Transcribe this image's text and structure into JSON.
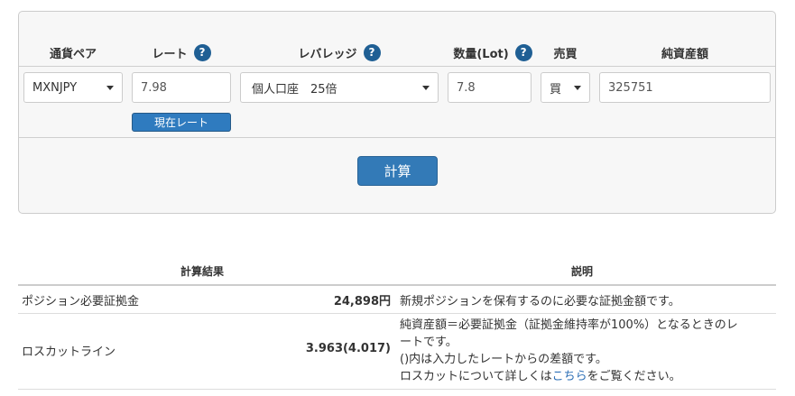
{
  "form": {
    "headers": {
      "pair": "通貨ペア",
      "rate": "レート",
      "leverage": "レバレッジ",
      "quantity": "数量(Lot)",
      "side": "売買",
      "equity": "純資産額"
    },
    "help_glyph": "?",
    "pair_value": "MXNJPY",
    "rate_value": "7.98",
    "leverage_value": "個人口座　25倍",
    "quantity_value": "7.8",
    "side_value": "買",
    "equity_value": "325751",
    "current_rate_button": "現在レート",
    "calc_button": "計算"
  },
  "results": {
    "col_result": "計算結果",
    "col_desc": "説明",
    "rows": [
      {
        "label": "ポジション必要証拠金",
        "value": "24,898円",
        "desc": [
          "新規ポジションを保有するのに必要な証拠金額です。"
        ]
      },
      {
        "label": "ロスカットライン",
        "value": "3.963(4.017)",
        "desc": [
          "純資産額＝必要証拠金（証拠金維持率が100%）となるときのレ",
          "ートです。",
          "()内は入力したレートからの差額です。"
        ],
        "desc_link_prefix": "ロスカットについて詳しくは",
        "desc_link": "こちら",
        "desc_link_suffix": "をご覧ください。"
      }
    ]
  }
}
